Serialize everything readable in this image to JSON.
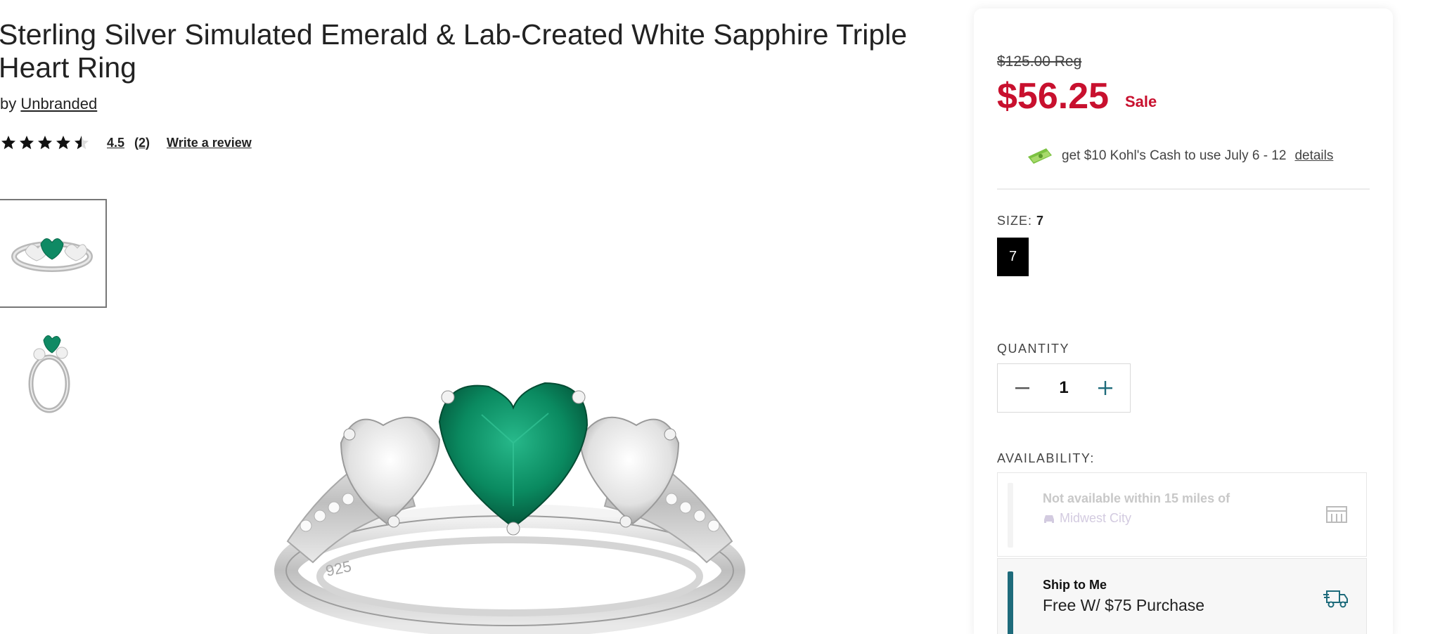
{
  "product": {
    "title": "Sterling Silver Simulated Emerald & Lab-Created White Sapphire Triple Heart Ring",
    "by_prefix": "by",
    "brand": "Unbranded",
    "rating": "4.5",
    "review_count": "(2)",
    "write_review": "Write a review",
    "stars_filled": 4.5
  },
  "gallery": {
    "thumbnails": [
      "front-view",
      "angled-view"
    ],
    "selected_index": 0
  },
  "pricing": {
    "regular": "$125.00 Reg",
    "sale": "$56.25",
    "sale_label": "Sale",
    "sale_color": "#c8102e"
  },
  "kohls_cash": {
    "text": "get $10 Kohl's Cash to use July 6 - 12",
    "details": "details"
  },
  "size": {
    "label": "SIZE:",
    "selected": "7",
    "options": [
      "7"
    ]
  },
  "quantity": {
    "label": "QUANTITY",
    "value": "1"
  },
  "availability": {
    "label": "AVAILABILITY:",
    "store": {
      "title": "Not available within 15 miles of",
      "city": "Midwest City"
    },
    "ship": {
      "title": "Ship to Me",
      "subtitle": "Free W/ $75 Purchase",
      "accent": "#1e6b7b"
    }
  }
}
